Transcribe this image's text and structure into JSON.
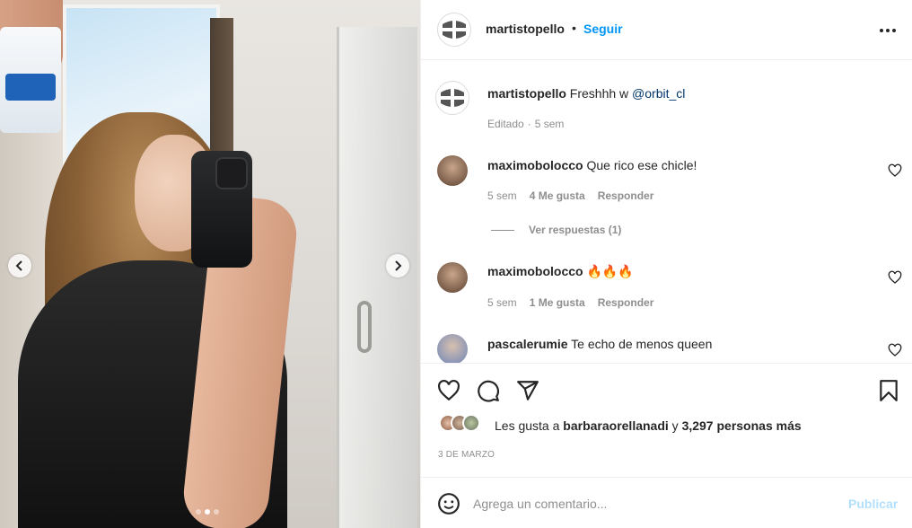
{
  "post": {
    "username": "martistopello",
    "separator": "•",
    "follow_label": "Seguir",
    "more_icon": "more-horizontal-icon"
  },
  "caption": {
    "username": "martistopello",
    "text": "Freshhh w ",
    "mention": "@orbit_cl",
    "edited": "Editado",
    "time": "5 sem"
  },
  "comments": [
    {
      "username": "maximobolocco",
      "text": "Que rico ese chicle!",
      "time": "5 sem",
      "likes": "4 Me gusta",
      "reply_label": "Responder",
      "view_replies": "Ver respuestas (1)"
    },
    {
      "username": "maximobolocco",
      "text": "🔥🔥🔥",
      "time": "5 sem",
      "likes": "1 Me gusta",
      "reply_label": "Responder"
    },
    {
      "username": "pascalerumie",
      "text": "Te echo de menos queen"
    }
  ],
  "likes": {
    "prefix": "Les gusta a ",
    "user": "barbaraorellanadi",
    "middle": " y ",
    "count": "3,297 personas más"
  },
  "date": "3 DE MARZO",
  "add_comment": {
    "placeholder": "Agrega un comentario...",
    "publish_label": "Publicar"
  },
  "carousel": {
    "slide_count": 3,
    "active_index": 1
  },
  "colors": {
    "accent": "#0095f6",
    "publish_disabled": "#b2dffc",
    "muted": "#8e8e8e",
    "text": "#262626",
    "mention": "#00376b"
  }
}
